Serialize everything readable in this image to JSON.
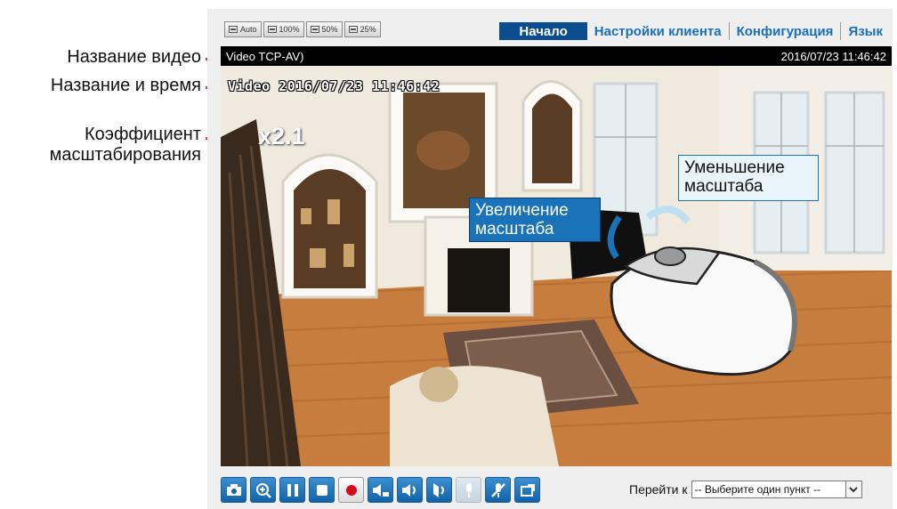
{
  "annotations": {
    "video_title": "Название видео",
    "title_time": "Название и время",
    "zoom_factor_line1": "Коэффициент",
    "zoom_factor_line2": "масштабирования"
  },
  "size_buttons": [
    "Auto",
    "100%",
    "50%",
    "25%"
  ],
  "nav": {
    "home": "Начало",
    "client_settings": "Настройки клиента",
    "configuration": "Конфигурация",
    "language": "Язык"
  },
  "titlebar": {
    "stream_prefix": "Video",
    "stream_suffix": " TCP-AV)",
    "timestamp": "2016/07/23 11:46:42"
  },
  "video": {
    "osd_text": "Video 2016/07/23 11:46:42",
    "zoom_factor": "x2.1",
    "zoom_in_line1": "Увеличение",
    "zoom_in_line2": "масштаба",
    "zoom_out_line1": "Уменьшение",
    "zoom_out_line2": "масштаба"
  },
  "toolbar": {
    "icons": [
      "camera-icon",
      "zoom-in-icon",
      "pause-icon",
      "stop-icon",
      "record-icon",
      "volume-down-icon",
      "speaker-icon",
      "talk-icon",
      "microphone-icon",
      "mute-mic-icon",
      "fullscreen-icon"
    ],
    "goto_label": "Перейти к",
    "goto_placeholder": "-- Выберите один пункт --"
  },
  "colors": {
    "accent": "#e0358a",
    "nav_active": "#0c4d8f",
    "nav_link": "#1a6fb5",
    "toolbar_button": "#1a72b8"
  }
}
